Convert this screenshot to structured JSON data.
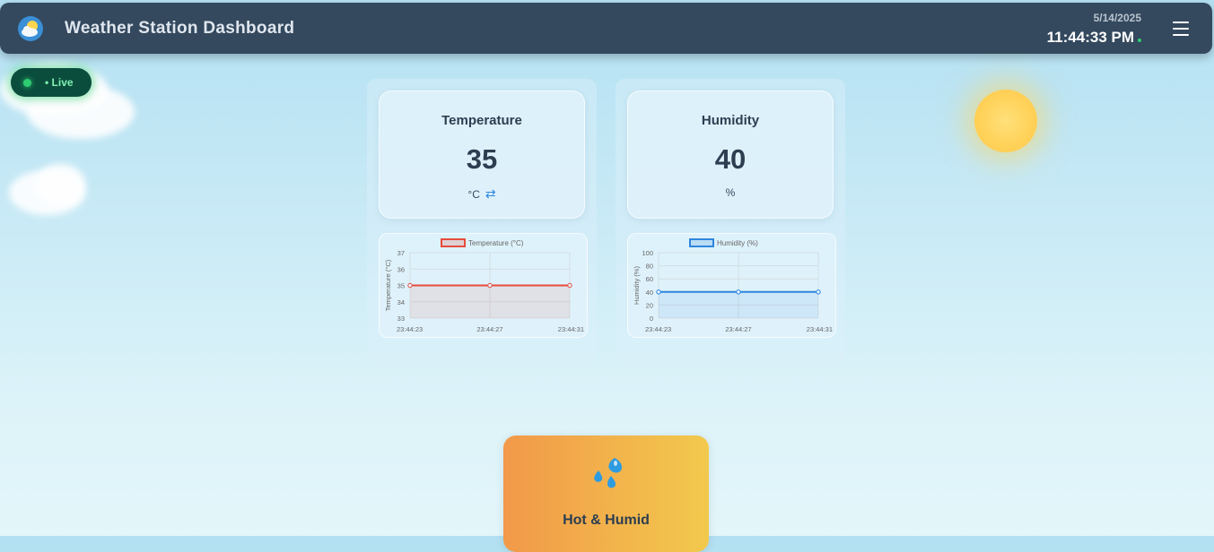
{
  "header": {
    "title": "Weather Station Dashboard",
    "date": "5/14/2025",
    "time": "11:44:33 PM",
    "menu_icon": "hamburger-menu-icon"
  },
  "status": {
    "label": "• Live",
    "color": "#2ecc71"
  },
  "temperature": {
    "title": "Temperature",
    "value": "35",
    "unit": "°C",
    "toggle_icon": "swap-arrows-icon"
  },
  "humidity": {
    "title": "Humidity",
    "value": "40",
    "unit": "%"
  },
  "condition": {
    "label": "Hot & Humid",
    "icon": "droplets-icon"
  },
  "chart_data": [
    {
      "type": "line",
      "legend": "Temperature (°C)",
      "ylabel": "Temperature (°C)",
      "x": [
        "23:44:23",
        "23:44:27",
        "23:44:31"
      ],
      "series": [
        {
          "name": "Temperature (°C)",
          "values": [
            35,
            35,
            35
          ]
        }
      ],
      "ylim": [
        33,
        37
      ],
      "yticks": [
        "37",
        "36",
        "35",
        "34",
        "33"
      ],
      "color": "#e74c3c",
      "grid": true,
      "legend_position": "top"
    },
    {
      "type": "line",
      "legend": "Humidity (%)",
      "ylabel": "Humidity (%)",
      "x": [
        "23:44:23",
        "23:44:27",
        "23:44:31"
      ],
      "series": [
        {
          "name": "Humidity (%)",
          "values": [
            40,
            40,
            40
          ]
        }
      ],
      "ylim": [
        0,
        100
      ],
      "yticks": [
        "100",
        "80",
        "60",
        "40",
        "20",
        "0"
      ],
      "color": "#2e86de",
      "grid": true,
      "legend_position": "top"
    }
  ]
}
